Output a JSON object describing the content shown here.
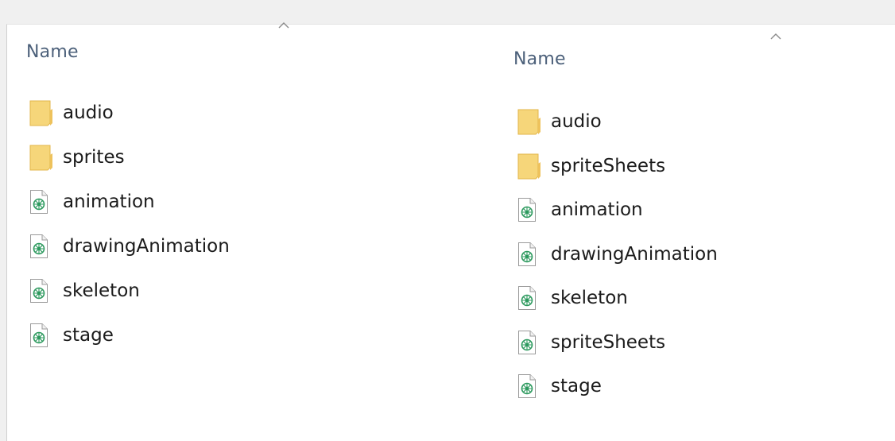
{
  "left_pane": {
    "column_header": "Name",
    "items": [
      {
        "name": "audio",
        "type": "folder"
      },
      {
        "name": "sprites",
        "type": "folder"
      },
      {
        "name": "animation",
        "type": "file"
      },
      {
        "name": "drawingAnimation",
        "type": "file"
      },
      {
        "name": "skeleton",
        "type": "file"
      },
      {
        "name": "stage",
        "type": "file"
      }
    ]
  },
  "right_pane": {
    "column_header": "Name",
    "items": [
      {
        "name": "audio",
        "type": "folder"
      },
      {
        "name": "spriteSheets",
        "type": "folder"
      },
      {
        "name": "animation",
        "type": "file"
      },
      {
        "name": "drawingAnimation",
        "type": "file"
      },
      {
        "name": "skeleton",
        "type": "file"
      },
      {
        "name": "spriteSheets",
        "type": "file"
      },
      {
        "name": "stage",
        "type": "file"
      }
    ]
  },
  "icons": {
    "folder": "folder-icon",
    "file": "json-file-icon",
    "sort": "sort-ascending-caret-icon"
  },
  "colors": {
    "folder": "#f6d67a",
    "file_glyph": "#2e9a5f",
    "header_text": "#4c607a"
  }
}
